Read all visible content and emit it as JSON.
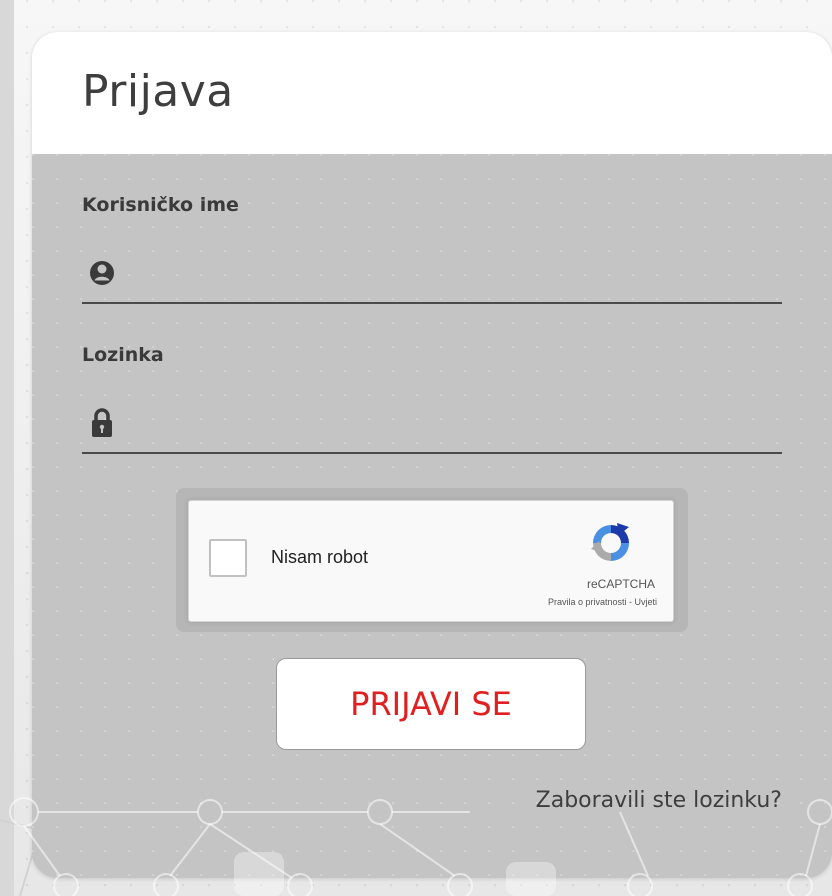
{
  "form": {
    "title": "Prijava",
    "username": {
      "label": "Korisničko ime",
      "value": "",
      "icon": "user-circle-icon"
    },
    "password": {
      "label": "Lozinka",
      "value": "",
      "icon": "lock-icon"
    },
    "captcha": {
      "label": "Nisam robot",
      "brand": "reCAPTCHA",
      "privacy": "Pravila o privatnosti",
      "separator": " - ",
      "terms": "Uvjeti",
      "checked": false
    },
    "submit_label": "PRIJAVI SE",
    "forgot_label": "Zaboravili ste lozinku?"
  },
  "colors": {
    "submit_text": "#e02020",
    "card_body": "#c4c4c4",
    "header_bg": "#ffffff"
  }
}
